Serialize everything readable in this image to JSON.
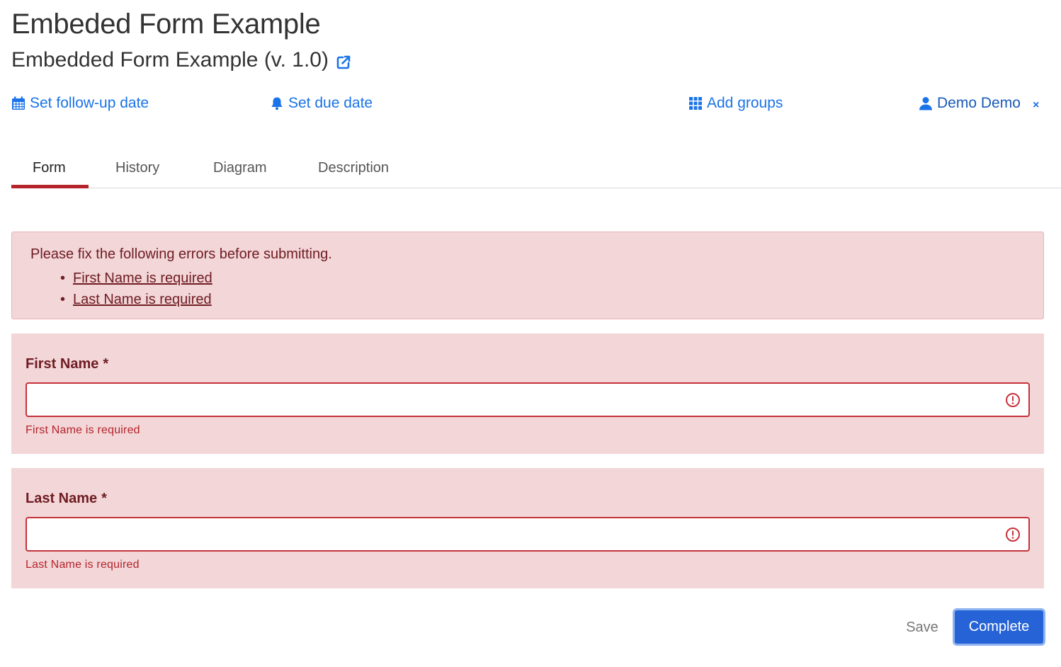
{
  "header": {
    "task_title": "Embeded Form Example",
    "process_name": "Embedded Form Example (v. 1.0)"
  },
  "actions": {
    "follow_up": "Set follow-up date",
    "due_date": "Set due date",
    "add_groups": "Add groups",
    "assignee": "Demo Demo",
    "remove_assignee": "×"
  },
  "tabs": [
    {
      "label": "Form",
      "active": true
    },
    {
      "label": "History",
      "active": false
    },
    {
      "label": "Diagram",
      "active": false
    },
    {
      "label": "Description",
      "active": false
    }
  ],
  "error_summary": {
    "lead": "Please fix the following errors before submitting.",
    "items": [
      "First Name is required",
      "Last Name is required"
    ]
  },
  "fields": [
    {
      "label": "First Name",
      "required_mark": "*",
      "value": "",
      "error": "First Name is required"
    },
    {
      "label": "Last Name",
      "required_mark": "*",
      "value": "",
      "error": "Last Name is required"
    }
  ],
  "buttons": {
    "save": "Save",
    "complete": "Complete"
  },
  "colors": {
    "link": "#1a73e8",
    "error_bg": "#f2d6d8",
    "error_text": "#6f1c22",
    "error_border": "#c6323a",
    "tab_underline": "#b5242b",
    "primary_button": "#2563d6"
  }
}
